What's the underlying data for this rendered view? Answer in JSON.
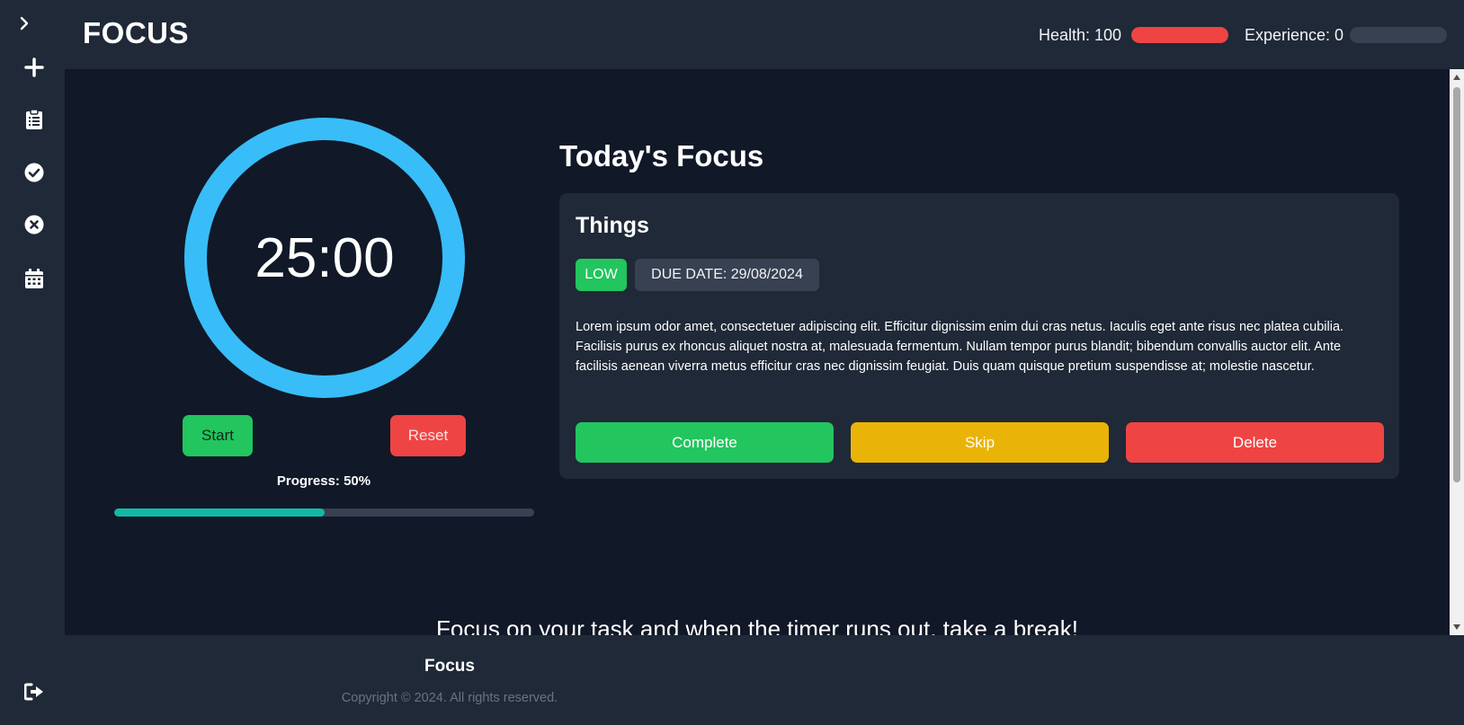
{
  "app": {
    "brand": "FOCUS"
  },
  "sidebar": {
    "items": [
      {
        "icon": "chevron-right-icon"
      },
      {
        "icon": "plus-icon"
      },
      {
        "icon": "clipboard-icon"
      },
      {
        "icon": "check-circle-icon"
      },
      {
        "icon": "x-circle-icon"
      },
      {
        "icon": "calendar-icon"
      }
    ],
    "logout_icon": "logout-icon"
  },
  "header": {
    "health_label": "Health: 100",
    "health_value": 100,
    "health_max": 100,
    "health_color": "#ef4444",
    "experience_label": "Experience: 0",
    "experience_value": 0,
    "experience_max": 100,
    "experience_color": "#14b8a6"
  },
  "timer": {
    "time": "25:00",
    "ring_color": "#38bdf8",
    "start_label": "Start",
    "reset_label": "Reset",
    "progress_label": "Progress: 50%",
    "progress_value": 0.5
  },
  "today": {
    "title": "Today's Focus",
    "task": {
      "name": "Things",
      "priority": "LOW",
      "due_date": "DUE DATE: 29/08/2024",
      "description": "Lorem ipsum odor amet, consectetuer adipiscing elit. Efficitur dignissim enim dui cras netus. Iaculis eget ante risus nec platea cubilia. Facilisis purus ex rhoncus aliquet nostra at, malesuada fermentum. Nullam tempor purus blandit; bibendum convallis auctor elit. Ante facilisis aenean viverra metus efficitur cras nec dignissim feugiat. Duis quam quisque pretium suspendisse at; molestie nascetur.",
      "complete_label": "Complete",
      "skip_label": "Skip",
      "delete_label": "Delete"
    }
  },
  "tagline": "Focus on your task and when the timer runs out, take a break!",
  "footer": {
    "title": "Focus",
    "copyright": "Copyright © 2024. All rights reserved."
  },
  "colors": {
    "background": "#111827",
    "panel": "#1f2937",
    "green": "#22c55e",
    "yellow": "#eab308",
    "red": "#ef4444",
    "teal": "#14b8a6"
  }
}
